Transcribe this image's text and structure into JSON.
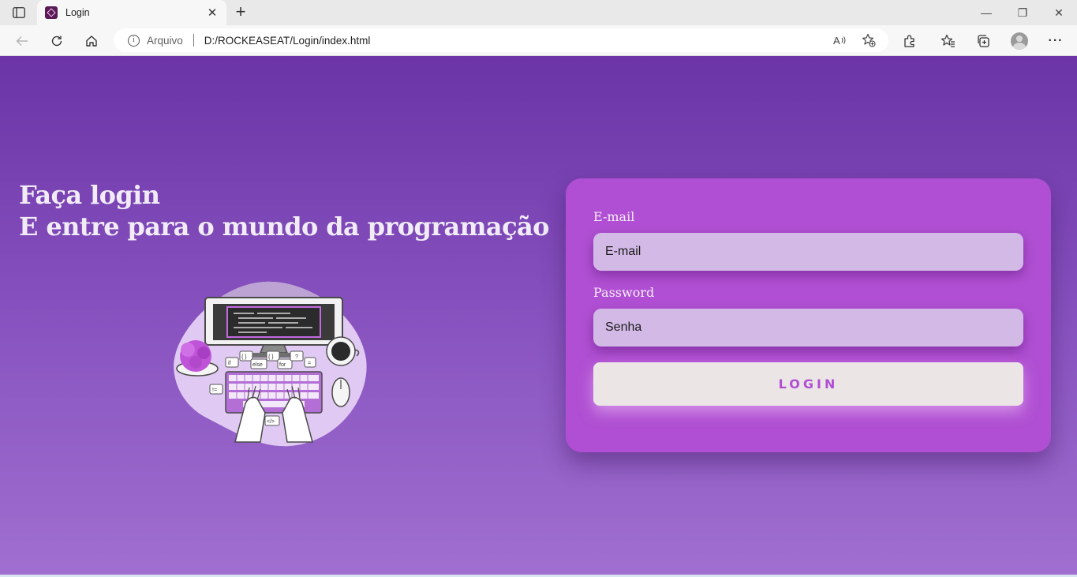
{
  "browser": {
    "tab": {
      "title": "Login",
      "close_glyph": "✕"
    },
    "new_tab_glyph": "+",
    "address": {
      "security_label": "Arquivo",
      "url": "D:/ROCKEASEAT/Login/index.html"
    },
    "window_controls": {
      "minimize": "—",
      "restore": "❐",
      "close": "✕"
    },
    "more_glyph": "···"
  },
  "page": {
    "headline_line1": "Faça login",
    "headline_line2": "E entre para o mundo da programação",
    "illustration": {
      "keywords": [
        "if",
        "{ }",
        "else",
        "{ }",
        "for",
        "?",
        "=",
        "!=",
        "</>"
      ]
    },
    "form": {
      "email_label": "E-mail",
      "email_placeholder": "E-mail",
      "password_label": "Password",
      "password_placeholder": "Senha",
      "submit_label": "LOGIN"
    }
  },
  "colors": {
    "background_top": "#6b34a7",
    "background_bottom": "#a06fd0",
    "card": "#b04fd3",
    "input": "#d2b9e6",
    "button": "#ebe5e6",
    "button_text": "#b04fd3"
  }
}
